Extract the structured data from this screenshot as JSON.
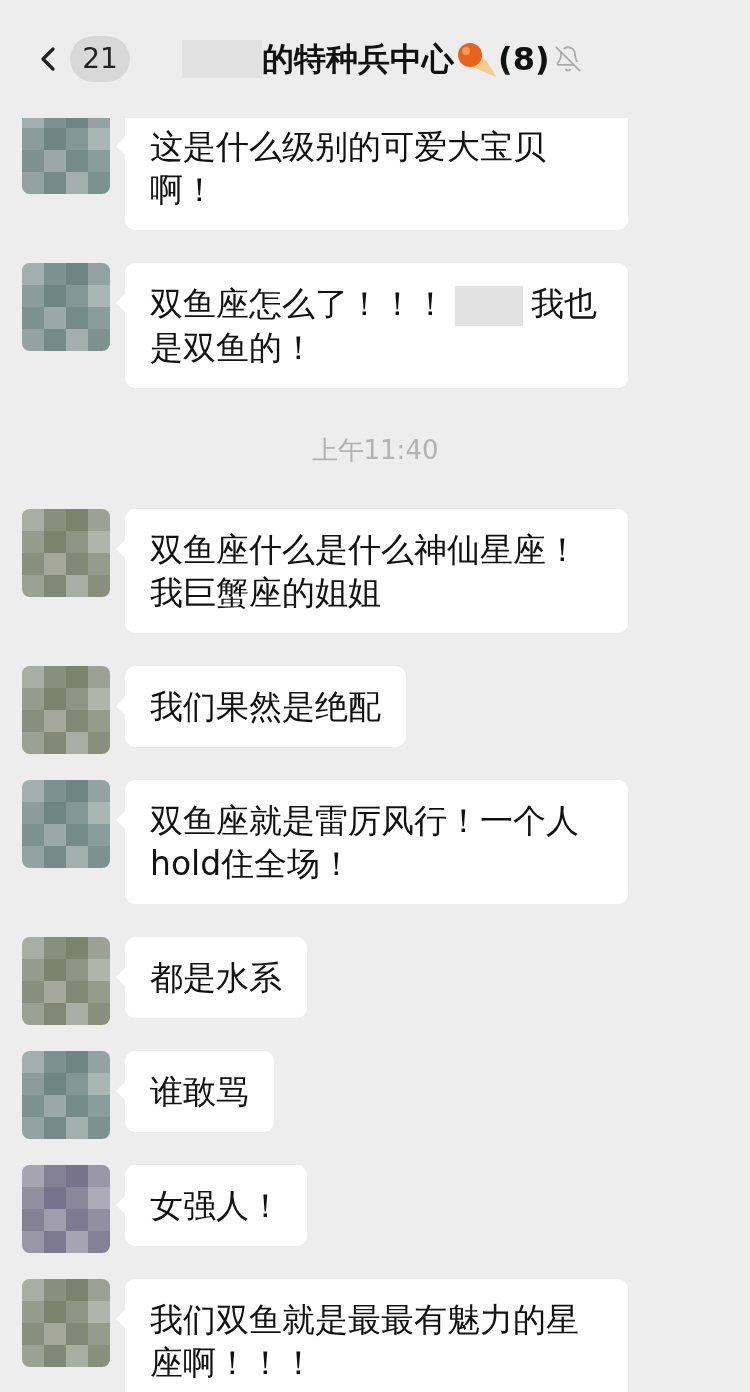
{
  "header": {
    "unread_count": "21",
    "title": [
      {
        "kind": "redaction"
      },
      {
        "kind": "text",
        "text": "的特种兵中心"
      }
    ],
    "member_count": "(8)",
    "muted": true
  },
  "feed": [
    {
      "kind": "message",
      "color": "#6f8582",
      "parts": [
        {
          "kind": "text",
          "text": "这是什么级别的可爱大宝贝啊！"
        }
      ]
    },
    {
      "kind": "message",
      "color": "#6f8582",
      "parts": [
        {
          "kind": "text",
          "text": "双鱼座怎么了！！！"
        },
        {
          "kind": "redaction"
        },
        {
          "kind": "text",
          "text": "我也"
        },
        {
          "kind": "text",
          "text": "是双鱼的！"
        }
      ]
    },
    {
      "kind": "time",
      "text": "上午11:40"
    },
    {
      "kind": "message",
      "color": "#7d826f",
      "parts": [
        {
          "kind": "text",
          "text": "双鱼座什么是什么神仙星座！我巨蟹座的姐姐"
        }
      ]
    },
    {
      "kind": "message",
      "color": "#7d826f",
      "parts": [
        {
          "kind": "text",
          "text": "我们果然是绝配"
        }
      ]
    },
    {
      "kind": "message",
      "color": "#6f8582",
      "parts": [
        {
          "kind": "text",
          "text": "双鱼座就是雷厉风行！一个人hold住全场！"
        }
      ]
    },
    {
      "kind": "message",
      "color": "#7d826f",
      "parts": [
        {
          "kind": "text",
          "text": "都是水系"
        }
      ]
    },
    {
      "kind": "message",
      "color": "#6f8582",
      "parts": [
        {
          "kind": "text",
          "text": "谁敢骂"
        }
      ]
    },
    {
      "kind": "message",
      "color": "#77738a",
      "parts": [
        {
          "kind": "text",
          "text": "女强人！"
        }
      ]
    },
    {
      "kind": "message",
      "color": "#7d826f",
      "parts": [
        {
          "kind": "text",
          "text": "我们双鱼就是最最有魅力的星座啊！！！"
        }
      ]
    }
  ]
}
